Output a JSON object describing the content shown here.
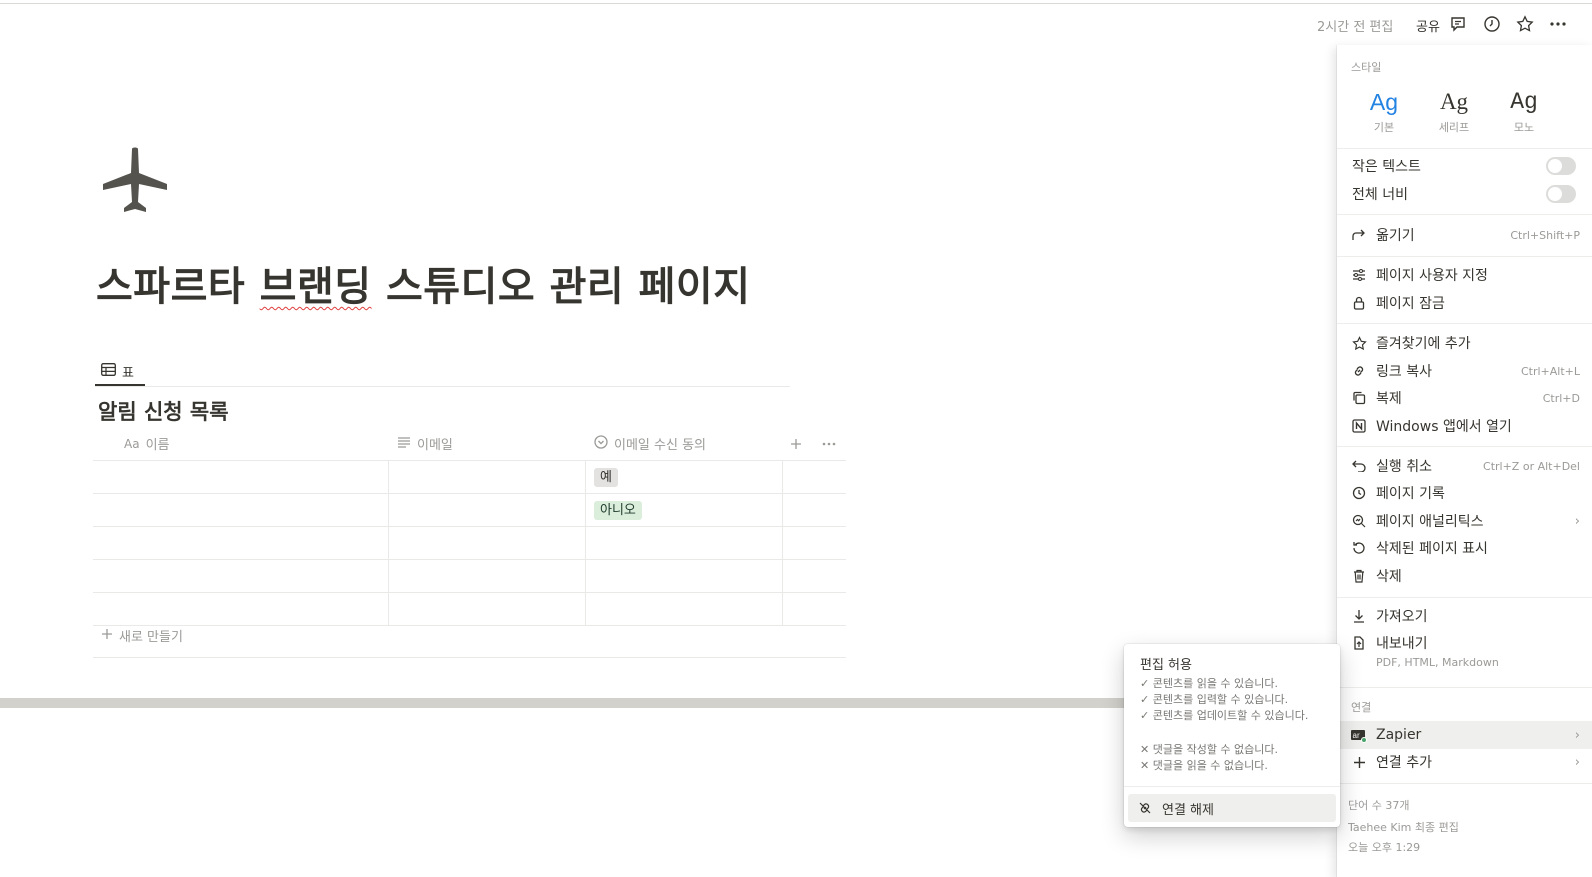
{
  "topbar": {
    "edited": "2시간 전 편집",
    "share": "공유",
    "icons": [
      "comment-icon",
      "clock-icon",
      "star-icon",
      "more-icon"
    ]
  },
  "page": {
    "icon": "airplane-icon",
    "title_before": "스파르타 ",
    "title_misspelled": "브랜딩",
    "title_after": " 스튜디오 관리 페이지"
  },
  "database": {
    "view_tab": "표",
    "title": "알림 신청 목록",
    "columns": [
      {
        "icon": "Aa",
        "label": "이름"
      },
      {
        "icon": "text-icon",
        "label": "이메일"
      },
      {
        "icon": "select-icon",
        "label": "이메일 수신 동의"
      }
    ],
    "rows": [
      {
        "name": "",
        "email": "",
        "consent": "예"
      },
      {
        "name": "",
        "email": "",
        "consent": "아니오"
      },
      {
        "name": "",
        "email": "",
        "consent": ""
      },
      {
        "name": "",
        "email": "",
        "consent": ""
      },
      {
        "name": "",
        "email": "",
        "consent": ""
      }
    ],
    "new_row": "새로 만들기",
    "tag_colors": {
      "예": "#e3e2e0",
      "아니오": "#dbeddb"
    }
  },
  "menu": {
    "style_label": "스타일",
    "styles": [
      {
        "sample": "Ag",
        "caption": "기본",
        "selected": true
      },
      {
        "sample": "Ag",
        "caption": "세리프",
        "selected": false
      },
      {
        "sample": "Ag",
        "caption": "모노",
        "selected": false
      }
    ],
    "toggles": [
      {
        "label": "작은 텍스트",
        "on": false
      },
      {
        "label": "전체 너비",
        "on": false
      }
    ],
    "items": {
      "move": {
        "label": "옮기기",
        "shortcut": "Ctrl+Shift+P"
      },
      "customize": {
        "label": "페이지 사용자 지정"
      },
      "lock": {
        "label": "페이지 잠금"
      },
      "favorite": {
        "label": "즐겨찾기에 추가"
      },
      "copy_link": {
        "label": "링크 복사",
        "shortcut": "Ctrl+Alt+L"
      },
      "duplicate": {
        "label": "복제",
        "shortcut": "Ctrl+D"
      },
      "open_windows": {
        "label": "Windows 앱에서 열기"
      },
      "undo": {
        "label": "실행 취소",
        "shortcut": "Ctrl+Z or Alt+Del"
      },
      "history": {
        "label": "페이지 기록"
      },
      "analytics": {
        "label": "페이지 애널리틱스"
      },
      "deleted": {
        "label": "삭제된 페이지 표시"
      },
      "delete": {
        "label": "삭제"
      },
      "import": {
        "label": "가져오기"
      },
      "export": {
        "label": "내보내기",
        "sub": "PDF, HTML, Markdown"
      }
    },
    "connections_label": "연결",
    "zapier": "Zapier",
    "add_connection": "연결 추가",
    "footer": {
      "word_count": "단어 수 37개",
      "last_edit": "Taehee Kim 최종 편집",
      "time": "오늘 오후 1:29"
    }
  },
  "popup": {
    "title": "편집 허용",
    "permissions": [
      {
        "allowed": true,
        "text": "콘텐츠를 읽을 수 있습니다."
      },
      {
        "allowed": true,
        "text": "콘텐츠를 입력할 수 있습니다."
      },
      {
        "allowed": true,
        "text": "콘텐츠를 업데이트할 수 있습니다."
      },
      {
        "allowed": false,
        "text": "댓글을 작성할 수 없습니다."
      },
      {
        "allowed": false,
        "text": "댓글을 읽을 수 없습니다."
      }
    ],
    "disconnect": "연결 해제"
  }
}
